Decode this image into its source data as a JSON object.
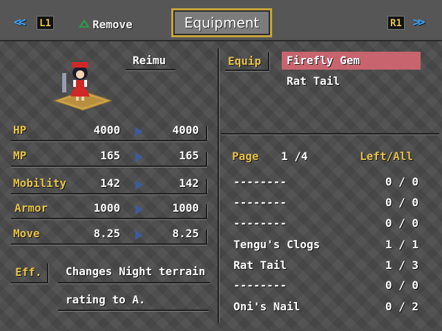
{
  "topbar": {
    "left_arrows": "<<",
    "left_button": "L1",
    "remove_label": "Remove",
    "title": "Equipment",
    "right_button": "R1",
    "right_arrows": ">>"
  },
  "character": {
    "name": "Reimu"
  },
  "stats": [
    {
      "label": "HP",
      "current": "4000",
      "new": "4000"
    },
    {
      "label": "MP",
      "current": "165",
      "new": "165"
    },
    {
      "label": "Mobility",
      "current": "142",
      "new": "142"
    },
    {
      "label": "Armor",
      "current": "1000",
      "new": "1000"
    },
    {
      "label": "Move",
      "current": "8.25",
      "new": "8.25"
    }
  ],
  "effect": {
    "label": "Eff.",
    "line1": "Changes Night terrain",
    "line2": "rating to A."
  },
  "equip": {
    "label": "Equip",
    "items": [
      "Firefly Gem",
      "Rat Tail"
    ],
    "selected_index": 0
  },
  "inventory": {
    "page_label": "Page",
    "page_value": "1 /4",
    "left_all_label": "Left/All",
    "rows": [
      {
        "name": "--------",
        "count": "0 / 0"
      },
      {
        "name": "--------",
        "count": "0 / 0"
      },
      {
        "name": "--------",
        "count": "0 / 0"
      },
      {
        "name": "Tengu's Clogs",
        "count": "1 / 1"
      },
      {
        "name": "Rat Tail",
        "count": "1 / 3"
      },
      {
        "name": "--------",
        "count": "0 / 0"
      },
      {
        "name": "Oni's Nail",
        "count": "0 / 2"
      }
    ]
  },
  "colors": {
    "label_gold": "#e6c34a",
    "arrow_blue": "#3aa6ff",
    "highlight_red": "#c8646e",
    "title_border": "#c9a53a"
  }
}
